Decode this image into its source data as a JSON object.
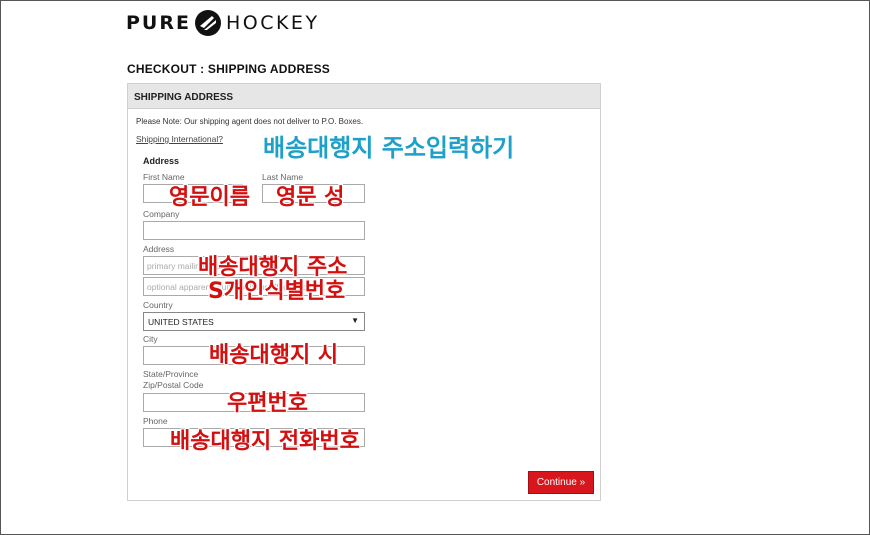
{
  "brand": {
    "left": "PURE",
    "right": "HOCKEY"
  },
  "page_title": "CHECKOUT : SHIPPING ADDRESS",
  "panel": {
    "header": "SHIPPING ADDRESS",
    "note": "Please Note: Our shipping agent does not deliver to P.O. Boxes.",
    "intl_link": "Shipping International?",
    "section_label": "Address"
  },
  "fields": {
    "first_name": {
      "label": "First Name",
      "value": ""
    },
    "last_name": {
      "label": "Last Name",
      "value": ""
    },
    "company": {
      "label": "Company",
      "value": ""
    },
    "address": {
      "label": "Address",
      "placeholder1": "primary mailing address",
      "placeholder2": "optional apparent, suite, building, floor, etc."
    },
    "country": {
      "label": "Country",
      "selected": "UNITED STATES"
    },
    "city": {
      "label": "City",
      "value": ""
    },
    "state": {
      "label": "State/Province"
    },
    "zip": {
      "label": "Zip/Postal Code",
      "value": ""
    },
    "phone": {
      "label": "Phone",
      "value": ""
    }
  },
  "continue_label": "Continue »",
  "annotations": {
    "title": "배송대행지 주소입력하기",
    "first_name": "영문이름",
    "last_name": "영문 성",
    "address": "배송대행지 주소",
    "personal_id": "S개인식별번호",
    "city": "배송대행지 시",
    "zip": "우편번호",
    "phone": "배송대행지 전화번호"
  },
  "colors": {
    "accent": "#d7161d",
    "annotation_red": "#d30f0f",
    "annotation_blue": "#1ea0c8"
  }
}
